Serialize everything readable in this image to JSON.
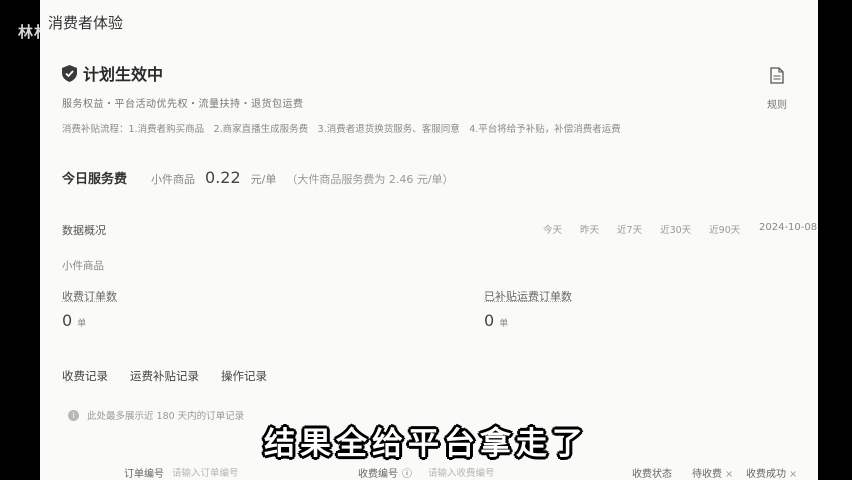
{
  "overlay": {
    "side_text": "林林",
    "subtitle": "结果全给平台拿走了"
  },
  "page": {
    "title": "消费者体验"
  },
  "plan": {
    "status": "计划生效中",
    "services": "服务权益・平台活动优先权・流量扶持・退货包运费",
    "process": "消费补贴流程：1.消费者购买商品　2.商家直播生成服务费　3.消费者退货换货服务、客服同意　4.平台将给予补贴，补偿消费者运费",
    "rules_label": "规则"
  },
  "fee": {
    "label": "今日服务费",
    "desc": "小件商品",
    "value": "0.22",
    "unit": "元/单",
    "note": "（大件商品服务费为 2.46 元/单）"
  },
  "data": {
    "title": "数据概况",
    "ranges": [
      "今天",
      "昨天",
      "近7天",
      "近30天",
      "近90天"
    ],
    "date": "2024-10-08",
    "category": "小件商品",
    "metrics": [
      {
        "label": "收费订单数",
        "value": "0",
        "unit": "单"
      },
      {
        "label": "已补贴运费订单数",
        "value": "0",
        "unit": "单"
      }
    ]
  },
  "tabs": [
    "收费记录",
    "运费补贴记录",
    "操作记录"
  ],
  "notice": "此处最多展示近 180 天内的订单记录",
  "filters": {
    "order_no_label": "订单编号",
    "order_no_placeholder": "请输入订单编号",
    "charge_no_label": "收费编号",
    "charge_no_placeholder": "请输入收费编号",
    "charge_status_label": "收费状态",
    "status_tags": [
      "待收费",
      "收费成功"
    ]
  },
  "colors": {
    "panel_bg": "#fafaf8",
    "frame_bg": "#000000",
    "subtitle": "#ffffff"
  }
}
